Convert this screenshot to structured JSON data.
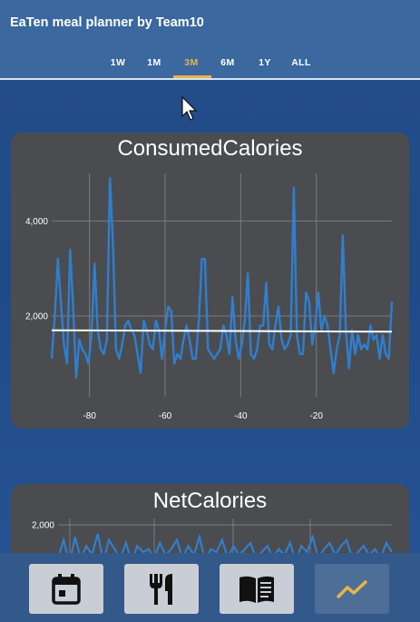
{
  "app": {
    "title": "EaTen meal planner by Team10"
  },
  "tabs": [
    {
      "label": "1W",
      "active": false
    },
    {
      "label": "1M",
      "active": false
    },
    {
      "label": "3M",
      "active": true
    },
    {
      "label": "6M",
      "active": false
    },
    {
      "label": "1Y",
      "active": false
    },
    {
      "label": "ALL",
      "active": false
    }
  ],
  "colors": {
    "accent": "#e6b44a",
    "appbar": "#3a689f",
    "card": "#4b4c50",
    "line": "#2f7fd0",
    "target": "#ffffff"
  },
  "cards": [
    {
      "title": "ConsumedCalories"
    },
    {
      "title": "NetCalories"
    }
  ],
  "bottom_nav": [
    {
      "icon": "calendar-icon",
      "active": false
    },
    {
      "icon": "fork-knife-icon",
      "active": false
    },
    {
      "icon": "book-icon",
      "active": false
    },
    {
      "icon": "trend-chart-icon",
      "active": true
    }
  ],
  "chart_data": [
    {
      "type": "line",
      "title": "ConsumedCalories",
      "xlabel": "",
      "ylabel": "",
      "xlim": [
        -90,
        0
      ],
      "ylim": [
        300,
        5000
      ],
      "grid": true,
      "x_ticks": [
        -80,
        -60,
        -40,
        -20
      ],
      "x_tick_labels": [
        "-80",
        "-60",
        "-40",
        "-20"
      ],
      "y_ticks": [
        2000,
        4000
      ],
      "y_tick_labels": [
        "2,000",
        "4,000"
      ],
      "series": [
        {
          "values": [
            1100,
            2000,
            3200,
            2300,
            1400,
            1000,
            3400,
            2200,
            700,
            1500,
            1300,
            1200,
            1000,
            1600,
            3100,
            1700,
            1300,
            1200,
            1500,
            4900,
            3500,
            1300,
            1100,
            1400,
            1800,
            1900,
            1700,
            1600,
            1200,
            800,
            1900,
            1700,
            1400,
            1300,
            1900,
            1700,
            1100,
            1700,
            2200,
            2100,
            1000,
            1200,
            1100,
            1500,
            1800,
            1500,
            1100,
            1100,
            1900,
            3200,
            3200,
            1300,
            1200,
            1100,
            1200,
            1300,
            1800,
            1600,
            1200,
            2400,
            1500,
            1100,
            1400,
            1900,
            2900,
            1200,
            1100,
            1300,
            1800,
            1800,
            2700,
            1400,
            1300,
            1800,
            2200,
            1500,
            1300,
            1400,
            1600,
            4700,
            1600,
            1200,
            1200,
            2500,
            2300,
            1400,
            1800,
            2500,
            1700,
            2000,
            1800,
            1300,
            800,
            1300,
            1600,
            3700,
            1700,
            900,
            1700,
            1200,
            1600,
            1300,
            1400,
            1300,
            1800,
            1500,
            1600,
            1100,
            1600,
            1200,
            1100,
            2300
          ]
        },
        {
          "name": "",
          "start": 1700,
          "end": 1670
        }
      ]
    },
    {
      "type": "line",
      "title": "NetCalories",
      "y_ticks": [
        2000
      ],
      "y_tick_labels": [
        "2,000"
      ],
      "series": [
        {
          "values": [
            900,
            1500,
            700,
            1600,
            900,
            1300,
            1000,
            1700,
            800,
            1500,
            1200,
            900,
            1400,
            800,
            1300,
            1100,
            1200,
            900,
            1400,
            1000,
            1200,
            1500,
            900,
            1300,
            1000,
            1600,
            800,
            1200,
            1100,
            1500,
            900,
            1300,
            1000,
            1200,
            1400,
            900,
            1100,
            1300,
            900,
            1200,
            1000,
            1400,
            800,
            1300,
            1100,
            1600,
            900,
            1200,
            1400,
            1000,
            1300,
            1500,
            900,
            1100,
            1300,
            1000,
            1200,
            900,
            1400,
            1100
          ]
        }
      ]
    }
  ]
}
